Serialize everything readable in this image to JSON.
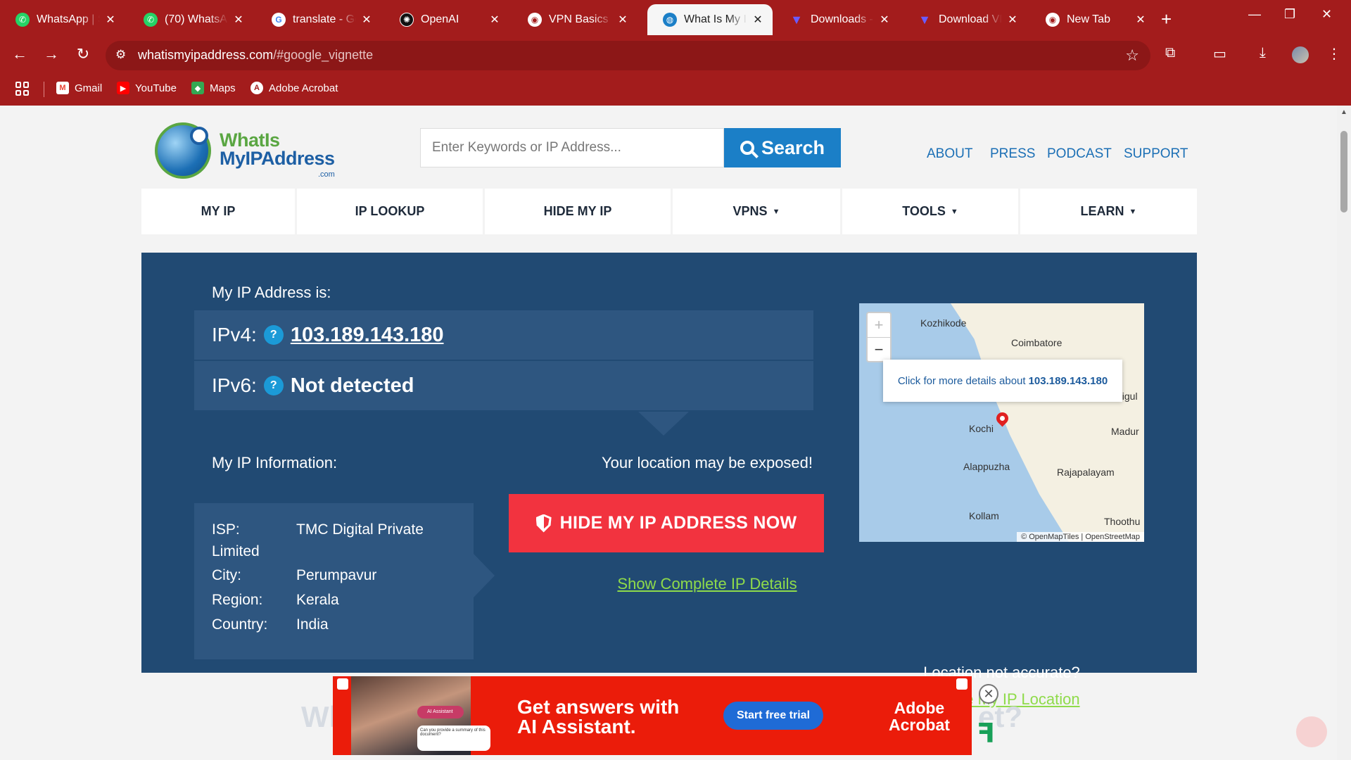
{
  "browser": {
    "tabs": [
      {
        "title": "WhatsApp | Se",
        "icon": "whatsapp-icon",
        "color": "#25d366"
      },
      {
        "title": "(70) WhatsApp",
        "icon": "whatsapp-icon",
        "color": "#25d366"
      },
      {
        "title": "translate - Go",
        "icon": "google-icon",
        "color": "#ffffff"
      },
      {
        "title": "OpenAI",
        "icon": "openai-icon",
        "color": "#111111"
      },
      {
        "title": "VPN Basics Gu",
        "icon": "chrome-icon",
        "color": "#ffffff"
      },
      {
        "title": "What Is My IP",
        "icon": "globe-icon",
        "color": "#1b7fc7",
        "active": true
      },
      {
        "title": "Downloads - I",
        "icon": "vpn-icon",
        "color": "#6a5cff"
      },
      {
        "title": "Download VPI",
        "icon": "vpn-icon",
        "color": "#6a5cff"
      },
      {
        "title": "New Tab",
        "icon": "chrome-icon",
        "color": "#ffffff"
      }
    ],
    "url_host": "whatismyipaddress.com",
    "url_path": "/#google_vignette",
    "bookmarks": [
      {
        "label": "Gmail",
        "icon": "gmail-icon",
        "color": "#ea4335"
      },
      {
        "label": "YouTube",
        "icon": "youtube-icon",
        "color": "#ff0000"
      },
      {
        "label": "Maps",
        "icon": "maps-icon",
        "color": "#34a853"
      },
      {
        "label": "Adobe Acrobat",
        "icon": "acrobat-icon",
        "color": "#ffffff"
      }
    ],
    "theme_color": "#a31c1c"
  },
  "site": {
    "logo": {
      "line1": "WhatIs",
      "line2": "MyIPAddress",
      "line3": ".com"
    },
    "search": {
      "placeholder": "Enter Keywords or IP Address...",
      "button": "Search"
    },
    "top_links": [
      "ABOUT",
      "PRESS",
      "PODCAST",
      "SUPPORT"
    ],
    "nav": [
      {
        "label": "MY IP",
        "dropdown": false
      },
      {
        "label": "IP LOOKUP",
        "dropdown": false
      },
      {
        "label": "HIDE MY IP",
        "dropdown": false
      },
      {
        "label": "VPNS",
        "dropdown": true
      },
      {
        "label": "TOOLS",
        "dropdown": true
      },
      {
        "label": "LEARN",
        "dropdown": true
      }
    ],
    "ip_panel": {
      "heading": "My IP Address is:",
      "ipv4_label": "IPv4:",
      "ipv4_value": "103.189.143.180",
      "ipv6_label": "IPv6:",
      "ipv6_value": "Not detected",
      "help_glyph": "?",
      "info_heading": "My IP Information:",
      "info": [
        {
          "key": "ISP:",
          "value": "TMC Digital Private",
          "wrap": "Limited"
        },
        {
          "key": "City:",
          "value": "Perumpavur"
        },
        {
          "key": "Region:",
          "value": "Kerala"
        },
        {
          "key": "Country:",
          "value": "India"
        }
      ],
      "exposed_text": "Your location may be exposed!",
      "hide_button": "HIDE MY IP ADDRESS NOW",
      "complete_link": "Show Complete IP Details",
      "map": {
        "cities": [
          "Kozhikode",
          "Coimbatore",
          "digul",
          "Kochi",
          "Madur",
          "Alappuzha",
          "Rajapalayam",
          "Kollam",
          "Thoothu"
        ],
        "popup_text": "Click for more details about",
        "popup_ip": "103.189.143.180",
        "attribution": "© OpenMapTiles | OpenStreetMap",
        "zoom_in": "+",
        "zoom_out": "−"
      },
      "location_question": "Location not accurate?",
      "location_link": "Update My IP Location"
    },
    "below_fold_fragments": [
      "Wh",
      "et?"
    ],
    "ad": {
      "headline_1": "Get answers with",
      "headline_2": "AI Assistant.",
      "cta": "Start free trial",
      "brand_1": "Adobe",
      "brand_2": "Acrobat",
      "chip": "AI Assistant",
      "bubble": "Can you provide a summary of this document?",
      "close": "✕"
    },
    "colors": {
      "panel": "#214a73",
      "box": "#2e5680",
      "accent_blue": "#1b7fc7",
      "cta_red": "#f2333f",
      "link_green": "#8fdb4a"
    }
  }
}
